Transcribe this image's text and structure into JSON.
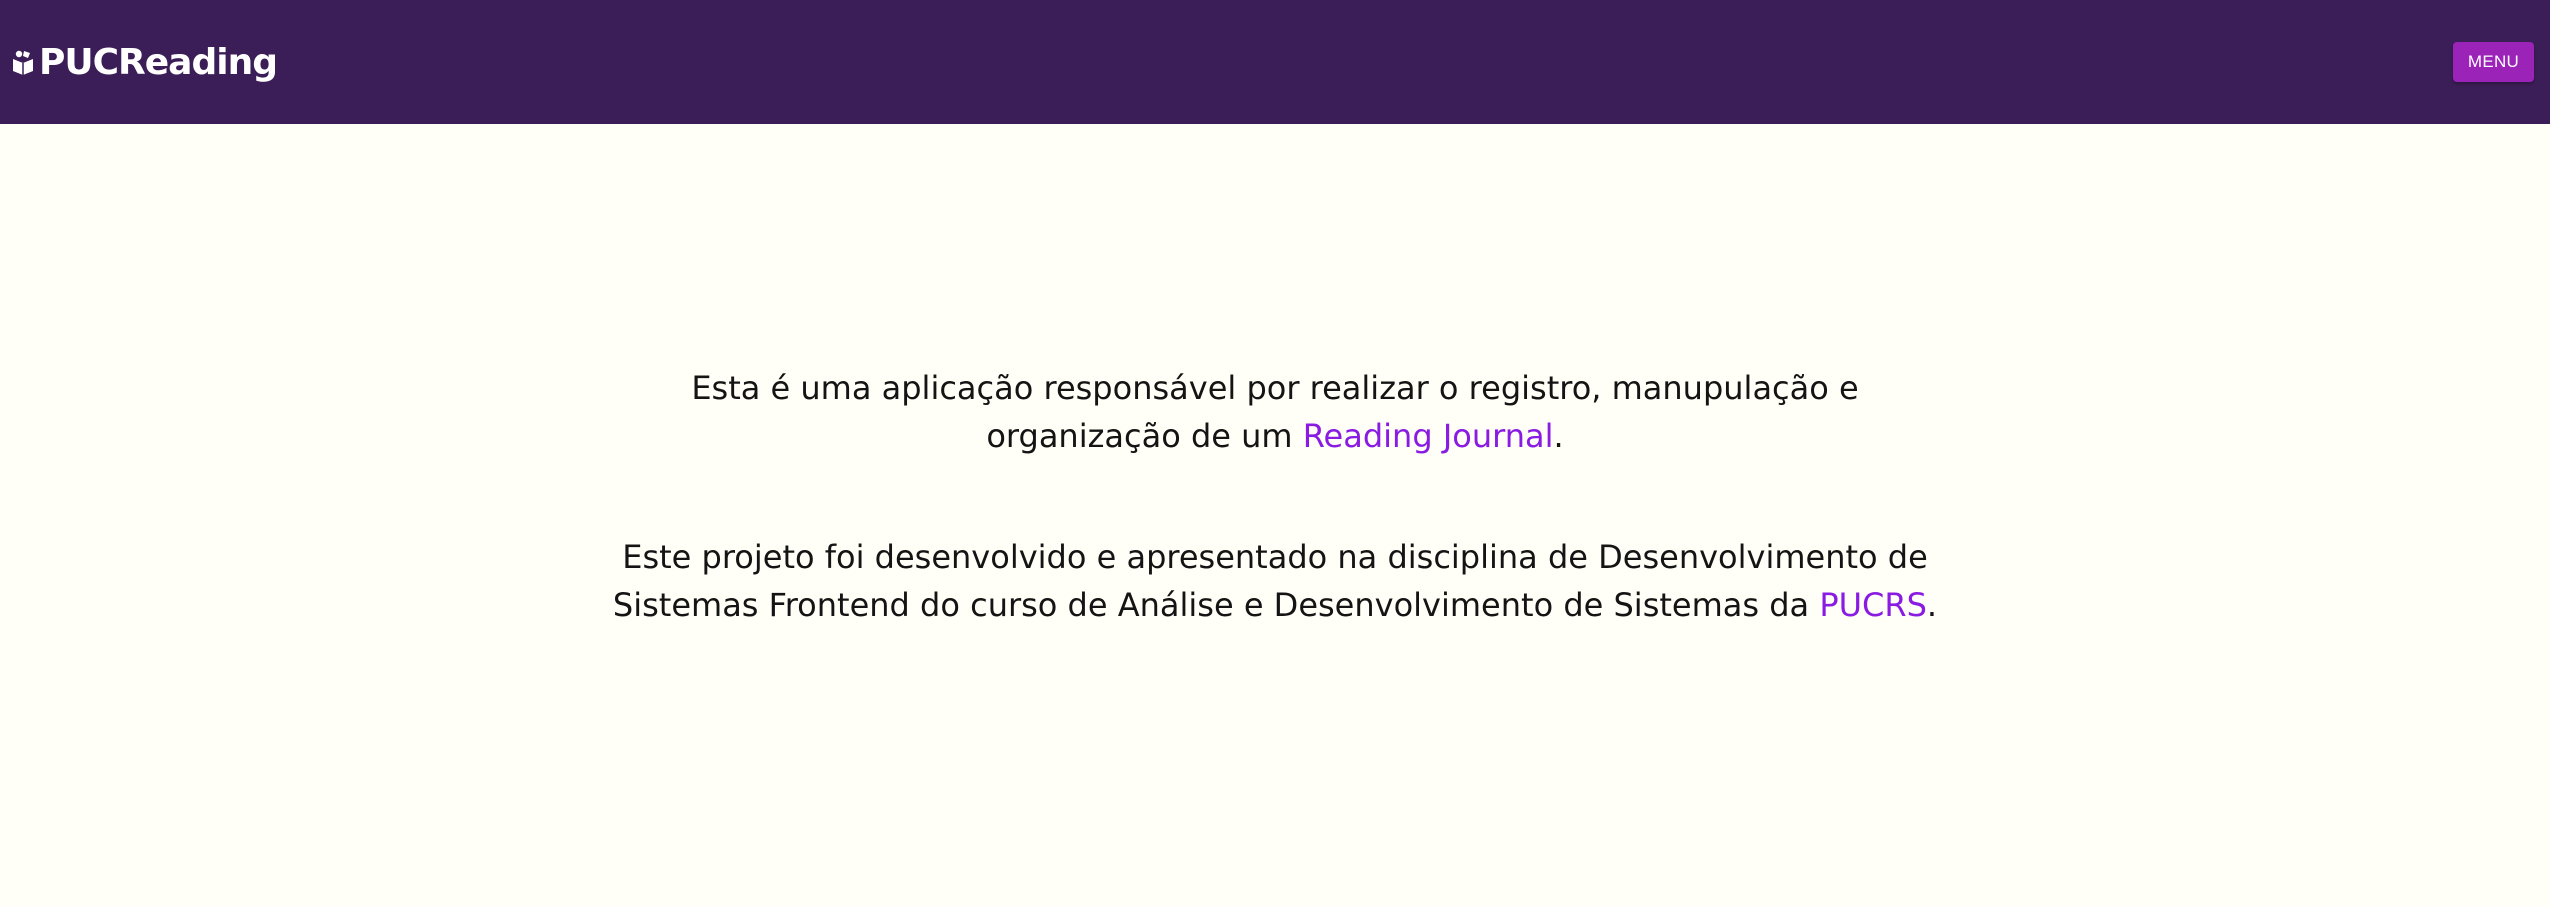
{
  "header": {
    "brand": "PUCReading",
    "menu_label": "MENU"
  },
  "about": {
    "p1_line1": "Esta é uma aplicação responsável por realizar o registro, manupulação e",
    "p1_line2_prefix": "organização de um ",
    "p1_link": "Reading Journal",
    "p1_suffix": ".",
    "p2_line1": "Este projeto foi desenvolvido e apresentado na disciplina de Desenvolvimento de",
    "p2_line2_prefix": "Sistemas Frontend do curso de Análise e Desenvolvimento de Sistemas da ",
    "p2_link": "PUCRS",
    "p2_suffix": "."
  },
  "colors": {
    "header_bg": "#3b1e57",
    "menu_button_bg": "#9b23b8",
    "page_bg": "#fffff7",
    "link": "#8a1be2"
  },
  "icons": {
    "brand": "book-icon"
  }
}
